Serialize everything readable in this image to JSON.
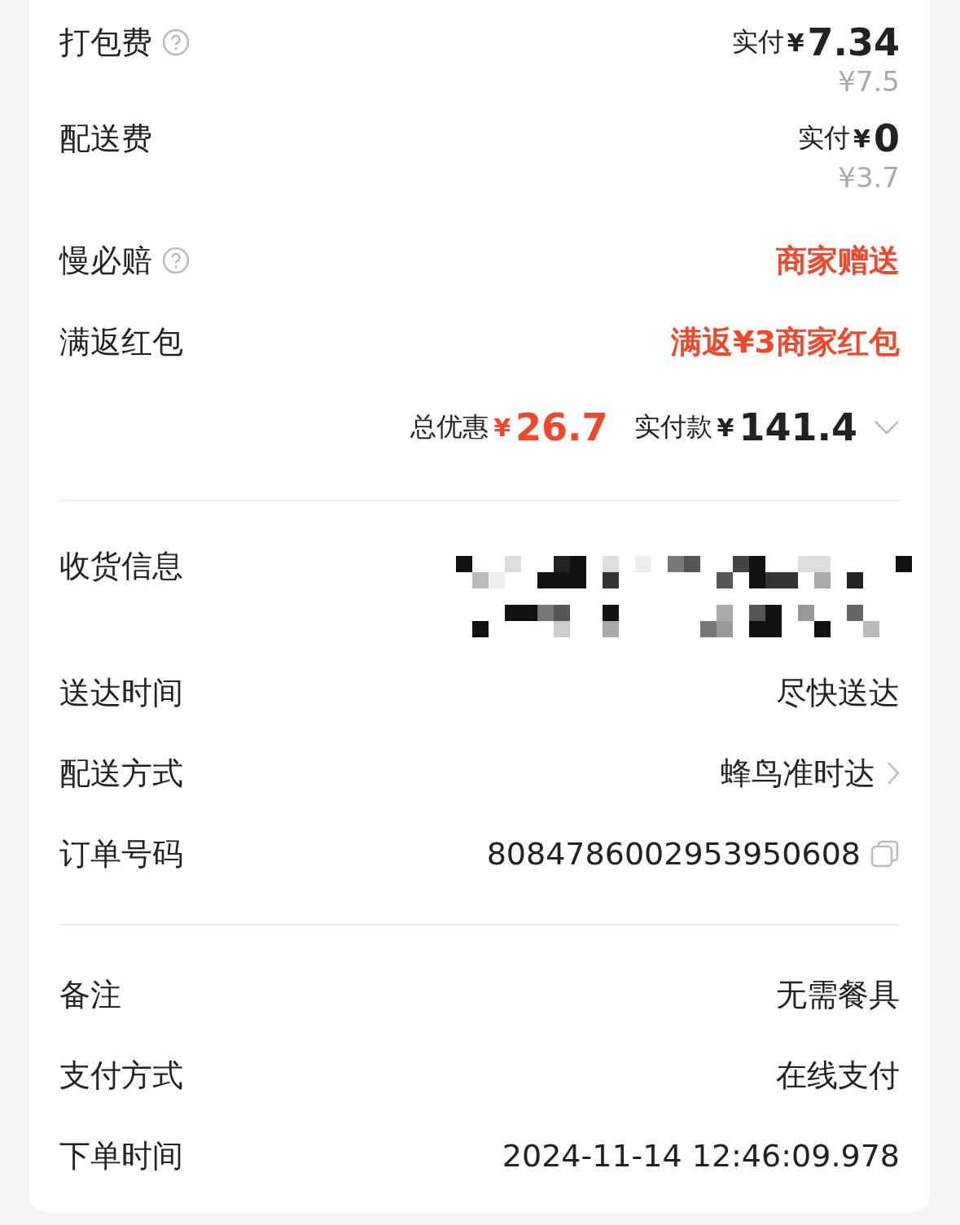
{
  "fees": [
    {
      "label": "打包费",
      "help": true,
      "kind": "price",
      "prefix": "实付",
      "currency": "¥",
      "amount": "7.34",
      "original": "¥7.5"
    },
    {
      "label": "配送费",
      "help": false,
      "kind": "price",
      "prefix": "实付",
      "currency": "¥",
      "amount": "0",
      "original": "¥3.7"
    },
    {
      "label": "慢必赔",
      "help": true,
      "kind": "promo",
      "value": "商家赠送"
    },
    {
      "label": "满返红包",
      "help": false,
      "kind": "promo",
      "value": "满返¥3商家红包"
    }
  ],
  "summary": {
    "discount_label": "总优惠",
    "discount_currency": "¥",
    "discount": "26.7",
    "paid_label": "实付款",
    "paid_currency": "¥",
    "paid": "141.4",
    "expanded": false
  },
  "info": [
    {
      "label": "收货信息",
      "kind": "redacted"
    },
    {
      "label": "送达时间",
      "kind": "text",
      "value": "尽快送达"
    },
    {
      "label": "配送方式",
      "kind": "link",
      "value": "蜂鸟准时达"
    },
    {
      "label": "订单号码",
      "kind": "copy",
      "value": "8084786002953950608"
    }
  ],
  "extra": [
    {
      "label": "备注",
      "value": "无需餐具"
    },
    {
      "label": "支付方式",
      "value": "在线支付"
    },
    {
      "label": "下单时间",
      "value": "2024-11-14 12:46:09.978"
    }
  ]
}
